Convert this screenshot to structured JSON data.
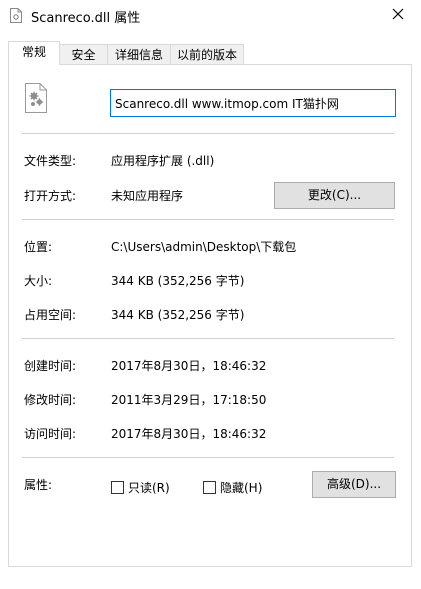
{
  "window": {
    "title": "Scanreco.dll 属性"
  },
  "tabs": [
    {
      "label": "常规",
      "active": true
    },
    {
      "label": "安全",
      "active": false
    },
    {
      "label": "详细信息",
      "active": false
    },
    {
      "label": "以前的版本",
      "active": false
    }
  ],
  "file": {
    "name_value": "Scanreco.dll www.itmop.com IT猫扑网"
  },
  "info": {
    "type_label": "文件类型:",
    "type_value": "应用程序扩展 (.dll)",
    "open_label": "打开方式:",
    "open_value": "未知应用程序",
    "change_button": "更改(C)...",
    "location_label": "位置:",
    "location_value": "C:\\Users\\admin\\Desktop\\下载包",
    "size_label": "大小:",
    "size_value": "344 KB (352,256 字节)",
    "disk_label": "占用空间:",
    "disk_value": "344 KB (352,256 字节)",
    "created_label": "创建时间:",
    "created_value": "2017年8月30日，18:46:32",
    "modified_label": "修改时间:",
    "modified_value": "2011年3月29日，17:18:50",
    "accessed_label": "访问时间:",
    "accessed_value": "2017年8月30日，18:46:32",
    "attr_label": "属性:",
    "readonly_label": "只读(R)",
    "hidden_label": "隐藏(H)",
    "advanced_button": "高级(D)..."
  },
  "icons": {
    "title_icon": "dll-file-icon",
    "close": "close-icon",
    "file_icon": "dll-gear-file-icon"
  },
  "colors": {
    "accent": "#0078d7",
    "button_bg": "#e1e1e1",
    "separator": "#cfcfcf"
  }
}
